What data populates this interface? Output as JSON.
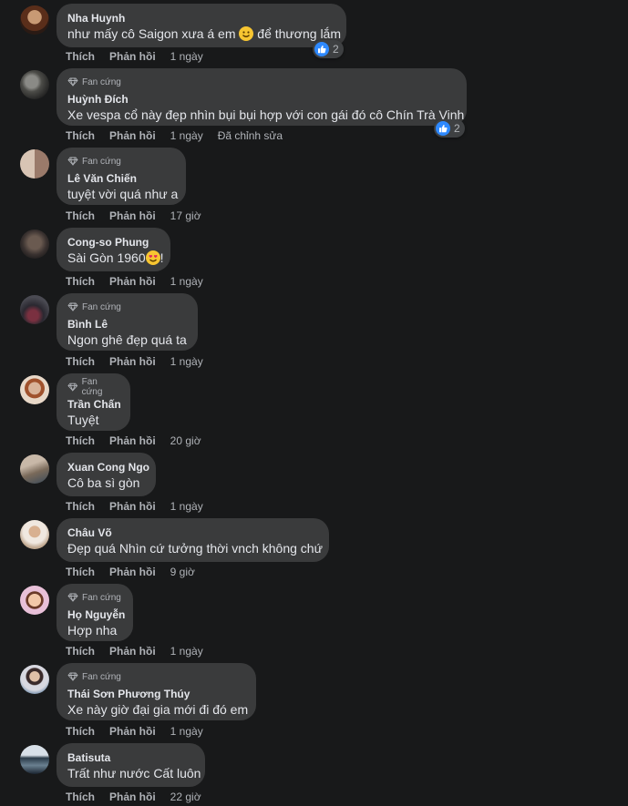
{
  "badge_label": "Fan cứng",
  "action_like": "Thích",
  "action_reply": "Phản hồi",
  "comments": [
    {
      "author": "Nha Huynh",
      "text_before": "như mấy cô Saigon xưa á em ",
      "text_after": " để thương lắm",
      "time": "1 ngày",
      "reactions": "2"
    },
    {
      "author": "Huỳnh Đích",
      "text": "Xe vespa cổ này đẹp nhìn bụi bụi hợp với con gái đó cô Chín Trà Vinh",
      "time": "1 ngày",
      "edited": "Đã chỉnh sửa",
      "reactions": "2"
    },
    {
      "author": "Lê Văn Chiến",
      "text": "tuyệt vời quá như a",
      "time": "17 giờ"
    },
    {
      "author": "Cong-so Phung",
      "text_before": "Sài Gòn 1960",
      "text_after": "!",
      "time": "1 ngày"
    },
    {
      "author": "Bình Lê",
      "text": "Ngon ghê đẹp quá ta",
      "time": "1 ngày"
    },
    {
      "author": "Trần Chấn",
      "text": "Tuyệt",
      "time": "20 giờ"
    },
    {
      "author": "Xuan Cong Ngo",
      "text": "Cô ba sì gòn",
      "time": "1 ngày"
    },
    {
      "author": "Châu Võ",
      "text": "Đẹp quá Nhìn cứ tưởng thời vnch không chứ",
      "time": "9 giờ"
    },
    {
      "author": "Họ Nguyễn",
      "text": "Hợp nha",
      "time": "1 ngày"
    },
    {
      "author": "Thái Sơn Phương Thúy",
      "text": "Xe này giờ đại gia mới đi đó em",
      "time": "1 ngày"
    },
    {
      "author": "Batisuta",
      "text": "Trất như nước Cất luôn",
      "time": "22 giờ"
    }
  ],
  "colors": {
    "background": "#18191a",
    "bubble": "#3a3b3c",
    "text_primary": "#e4e6eb",
    "text_secondary": "#b0b3b8",
    "like_blue": "#2e89ff"
  }
}
